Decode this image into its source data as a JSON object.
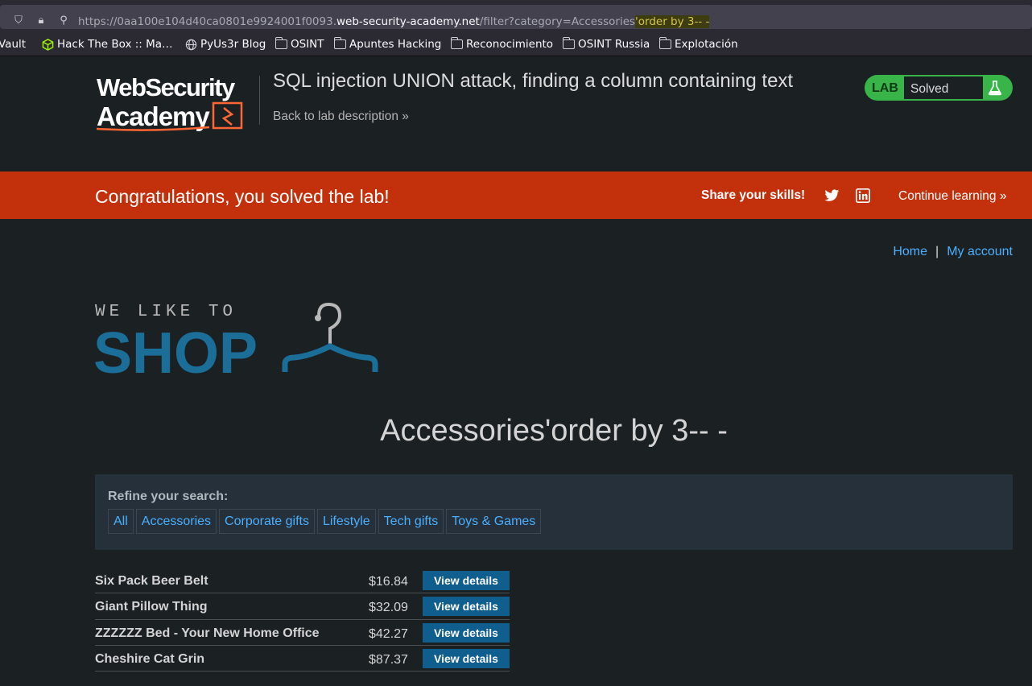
{
  "browser": {
    "url_prefix": "https://0aa100e104d40ca0801e9924001f0093.",
    "url_host": "web-security-academy.net",
    "url_path": "/filter?category=Accessories",
    "url_injected": "'order by 3-- -",
    "bookmarks": [
      "Vault",
      "Hack The Box :: Ma…",
      "PyUs3r Blog",
      "OSINT",
      "Apuntes Hacking",
      "Reconocimiento",
      "OSINT Russia",
      "Explotación"
    ]
  },
  "header": {
    "logo_line1": "WebSecurity",
    "logo_line2": "Academy",
    "lab_title": "SQL injection UNION attack, finding a column containing text",
    "back_link": "Back to lab description",
    "lab_label": "LAB",
    "lab_status": "Solved"
  },
  "banner": {
    "message": "Congratulations, you solved the lab!",
    "share": "Share your skills!",
    "continue": "Continue learning"
  },
  "nav": {
    "home": "Home",
    "separator": "|",
    "account": "My account"
  },
  "shop": {
    "line1": "WE LIKE TO",
    "line2": "SHOP"
  },
  "heading": "Accessories'order by 3-- -",
  "refine": {
    "title": "Refine your search:",
    "filters": [
      "All",
      "Accessories",
      "Corporate gifts",
      "Lifestyle",
      "Tech gifts",
      "Toys & Games"
    ]
  },
  "products": [
    {
      "name": "Six Pack Beer Belt",
      "price": "$16.84",
      "action": "View details"
    },
    {
      "name": "Giant Pillow Thing",
      "price": "$32.09",
      "action": "View details"
    },
    {
      "name": "ZZZZZZ Bed - Your New Home Office",
      "price": "$42.27",
      "action": "View details"
    },
    {
      "name": "Cheshire Cat Grin",
      "price": "$87.37",
      "action": "View details"
    }
  ],
  "colors": {
    "banner": "#c3310c",
    "link": "#4aaffe",
    "badge": "#38b449",
    "button": "#0f5e8d",
    "shop_blue": "#1b6e98"
  }
}
